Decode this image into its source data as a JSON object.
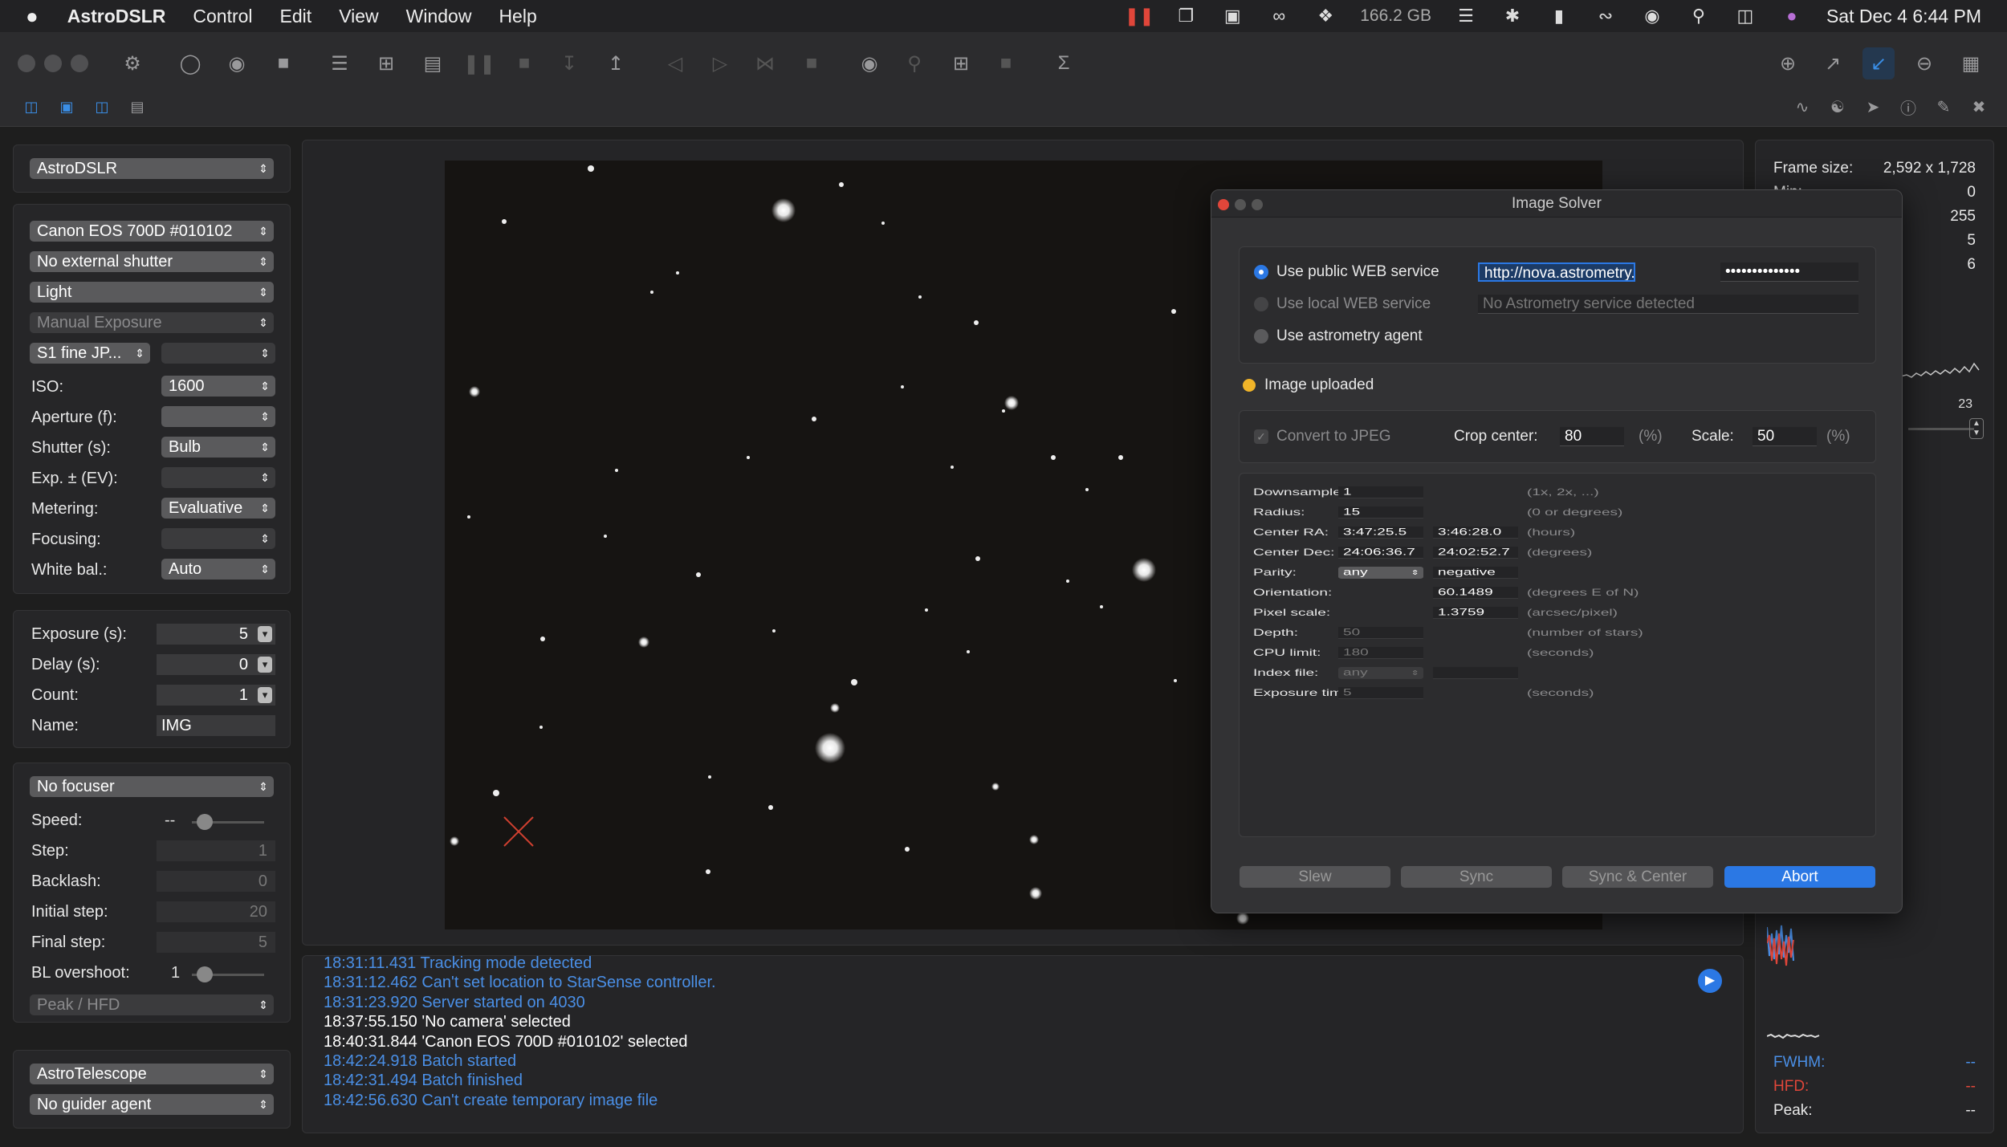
{
  "menubar": {
    "app_name": "AstroDSLR",
    "menus": [
      "Control",
      "Edit",
      "View",
      "Window",
      "Help"
    ],
    "disk": "166.2 GB",
    "clock": "Sat Dec 4  6:44 PM"
  },
  "left": {
    "driver": "AstroDSLR",
    "camera": {
      "device": "Canon EOS 700D #010102",
      "shutter": "No external shutter",
      "frame": "Light",
      "mode": "Manual Exposure",
      "format": "S1 fine JP...",
      "format2": "",
      "iso_label": "ISO:",
      "iso": "1600",
      "aperture_label": "Aperture (f):",
      "aperture": "",
      "shutter_label": "Shutter (s):",
      "shutter_value": "Bulb",
      "exp_label": "Exp. ± (EV):",
      "exp": "",
      "metering_label": "Metering:",
      "metering": "Evaluative",
      "focusing_label": "Focusing:",
      "focusing": "",
      "wb_label": "White bal.:",
      "wb": "Auto"
    },
    "batch": {
      "exposure_label": "Exposure (s):",
      "exposure": "5",
      "delay_label": "Delay (s):",
      "delay": "0",
      "count_label": "Count:",
      "count": "1",
      "name_label": "Name:",
      "name": "IMG"
    },
    "focuser": {
      "device": "No focuser",
      "speed_label": "Speed:",
      "speed": "--",
      "step_label": "Step:",
      "step": "1",
      "backlash_label": "Backlash:",
      "backlash": "0",
      "initial_label": "Initial step:",
      "initial": "20",
      "final_label": "Final step:",
      "final": "5",
      "bl_label": "BL overshoot:",
      "bl": "1",
      "metric": "Peak / HFD"
    },
    "telescope": "AstroTelescope",
    "guider": "No guider agent"
  },
  "log": {
    "lines": [
      {
        "text": "18:31:11.431 Tracking mode detected",
        "color": "#4a8fe6"
      },
      {
        "text": "18:31:12.462 Can't set location to StarSense controller.",
        "color": "#4a8fe6"
      },
      {
        "text": "18:31:23.920 Server started on 4030",
        "color": "#4a8fe6"
      },
      {
        "text": "18:37:55.150 'No camera' selected",
        "color": "#ffffff"
      },
      {
        "text": "18:40:31.844 'Canon EOS 700D #010102' selected",
        "color": "#ffffff"
      },
      {
        "text": "18:42:24.918 Batch started",
        "color": "#4a8fe6"
      },
      {
        "text": "18:42:31.494 Batch finished",
        "color": "#4a8fe6"
      },
      {
        "text": "18:42:56.630 Can't create temporary image file",
        "color": "#4a8fe6"
      }
    ]
  },
  "right": {
    "frame_label": "Frame size:",
    "frame": "2,592 x 1,728",
    "min_label": "Min:",
    "min": "0",
    "max": "255",
    "v3": "5",
    "v4": "6",
    "hist_val": "23",
    "fwhm_label": "FWHM:",
    "fwhm": "--",
    "hfd_label": "HFD:",
    "hfd": "--",
    "peak_label": "Peak:",
    "peak": "--",
    "color_fwhm": "#4a8fe6",
    "color_hfd": "#e0463a"
  },
  "solver": {
    "title": "Image Solver",
    "opt_public": "Use public WEB service",
    "public_url": "http://nova.astrometry.net",
    "api_key": "••••••••••••••",
    "opt_local": "Use local WEB service",
    "local_status": "No Astrometry service detected",
    "opt_agent": "Use astrometry agent",
    "status": "Image uploaded",
    "convert": "Convert to JPEG",
    "crop_label": "Crop center:",
    "crop": "80",
    "pct1": "(%)",
    "scale_label": "Scale:",
    "scale": "50",
    "pct2": "(%)",
    "params": {
      "downsample_label": "Downsample:",
      "downsample": "1",
      "downsample_hint": "(1x, 2x, ...)",
      "radius_label": "Radius:",
      "radius": "15",
      "radius_hint": "(0 or degrees)",
      "ra_label": "Center RA:",
      "ra": "3:47:25.5",
      "ra2": "3:46:28.0",
      "ra_hint": "(hours)",
      "dec_label": "Center Dec:",
      "dec": "24:06:36.7",
      "dec2": "24:02:52.7",
      "dec_hint": "(degrees)",
      "parity_label": "Parity:",
      "parity": "any",
      "parity2": "negative",
      "orient_label": "Orientation:",
      "orient": "60.1489",
      "orient_hint": "(degrees E of N)",
      "pix_label": "Pixel scale:",
      "pix": "1.3759",
      "pix_hint": "(arcsec/pixel)",
      "depth_label": "Depth:",
      "depth": "50",
      "depth_hint": "(number of stars)",
      "cpu_label": "CPU limit:",
      "cpu": "180",
      "cpu_hint": "(seconds)",
      "index_label": "Index file:",
      "index": "any",
      "exptime_label": "Exposure time:",
      "exptime": "5",
      "exptime_hint": "(seconds)"
    },
    "buttons": {
      "slew": "Slew",
      "sync": "Sync",
      "sync_center": "Sync & Center",
      "abort": "Abort"
    },
    "accent": "#2b78e4"
  }
}
